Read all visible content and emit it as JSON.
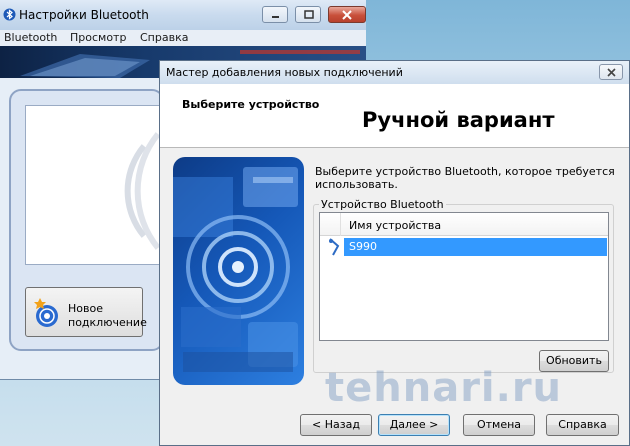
{
  "bg_window": {
    "title": "Настройки Bluetooth",
    "menu": [
      "Bluetooth",
      "Просмотр",
      "Справка"
    ],
    "new_connection": {
      "line1": "Новое",
      "line2": "подключение"
    }
  },
  "wizard": {
    "title": "Мастер добавления новых подключений",
    "step_title": "Выберите устройство",
    "big_title": "Ручной вариант",
    "description_line1": "Выберите устройство Bluetooth, которое требуется",
    "description_line2": "использовать.",
    "group_label": "Устройство Bluetooth",
    "column_header": "Имя устройства",
    "devices": [
      {
        "name": "S990",
        "selected": true,
        "icon": "phone-icon"
      }
    ],
    "refresh_button": "Обновить",
    "back_button": "< Назад",
    "next_button": "Далее >",
    "cancel_button": "Отмена",
    "help_button": "Справка"
  },
  "watermark": "tehnari.ru",
  "colors": {
    "selection": "#3399ff",
    "banner": "#173a6c",
    "image_blue": "#1558b8"
  }
}
